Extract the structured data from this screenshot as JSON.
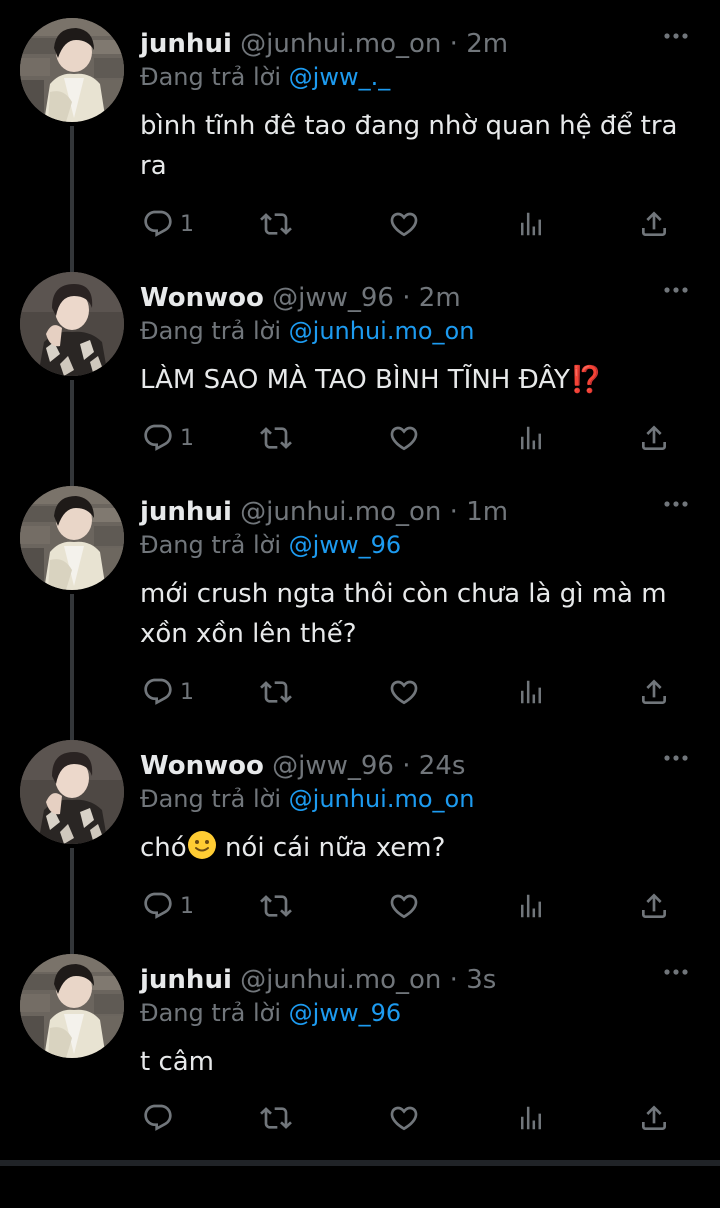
{
  "colors": {
    "background": "#000000",
    "text_primary": "#e7e9ea",
    "text_secondary": "#71767b",
    "mention": "#1d9bf0",
    "thread_line": "#333639"
  },
  "replying_prefix": "Đang trả lời",
  "icons": {
    "reply": "reply-icon",
    "retweet": "retweet-icon",
    "like": "heart-icon",
    "views": "views-icon",
    "share": "share-icon",
    "more": "more-icon"
  },
  "tweets": [
    {
      "name": "junhui",
      "handle": "@junhui.mo_on",
      "separator": "·",
      "time": "2m",
      "replying_to": "@jww_._",
      "text": "bình tĩnh đê tao đang nhờ quan hệ để tra ra",
      "reply_count": "1"
    },
    {
      "name": "Wonwoo",
      "handle": "@jww_96",
      "separator": "·",
      "time": "2m",
      "replying_to": "@junhui.mo_on",
      "text": "LÀM SAO MÀ TAO BÌNH TĨNH ĐÂY",
      "text_emoji": "⁉️",
      "reply_count": "1"
    },
    {
      "name": "junhui",
      "handle": "@junhui.mo_on",
      "separator": "·",
      "time": "1m",
      "replying_to": "@jww_96",
      "text": "mới crush ngta thôi còn chưa là gì mà m xồn xồn lên thế?",
      "reply_count": "1"
    },
    {
      "name": "Wonwoo",
      "handle": "@jww_96",
      "separator": "·",
      "time": "24s",
      "replying_to": "@junhui.mo_on",
      "text_before_emoji": "chó",
      "text_emoji": "🙂",
      "text_after_emoji": " nói cái nữa xem?",
      "reply_count": "1"
    },
    {
      "name": "junhui",
      "handle": "@junhui.mo_on",
      "separator": "·",
      "time": "3s",
      "replying_to": "@jww_96",
      "text": "t câm",
      "reply_count": ""
    }
  ]
}
